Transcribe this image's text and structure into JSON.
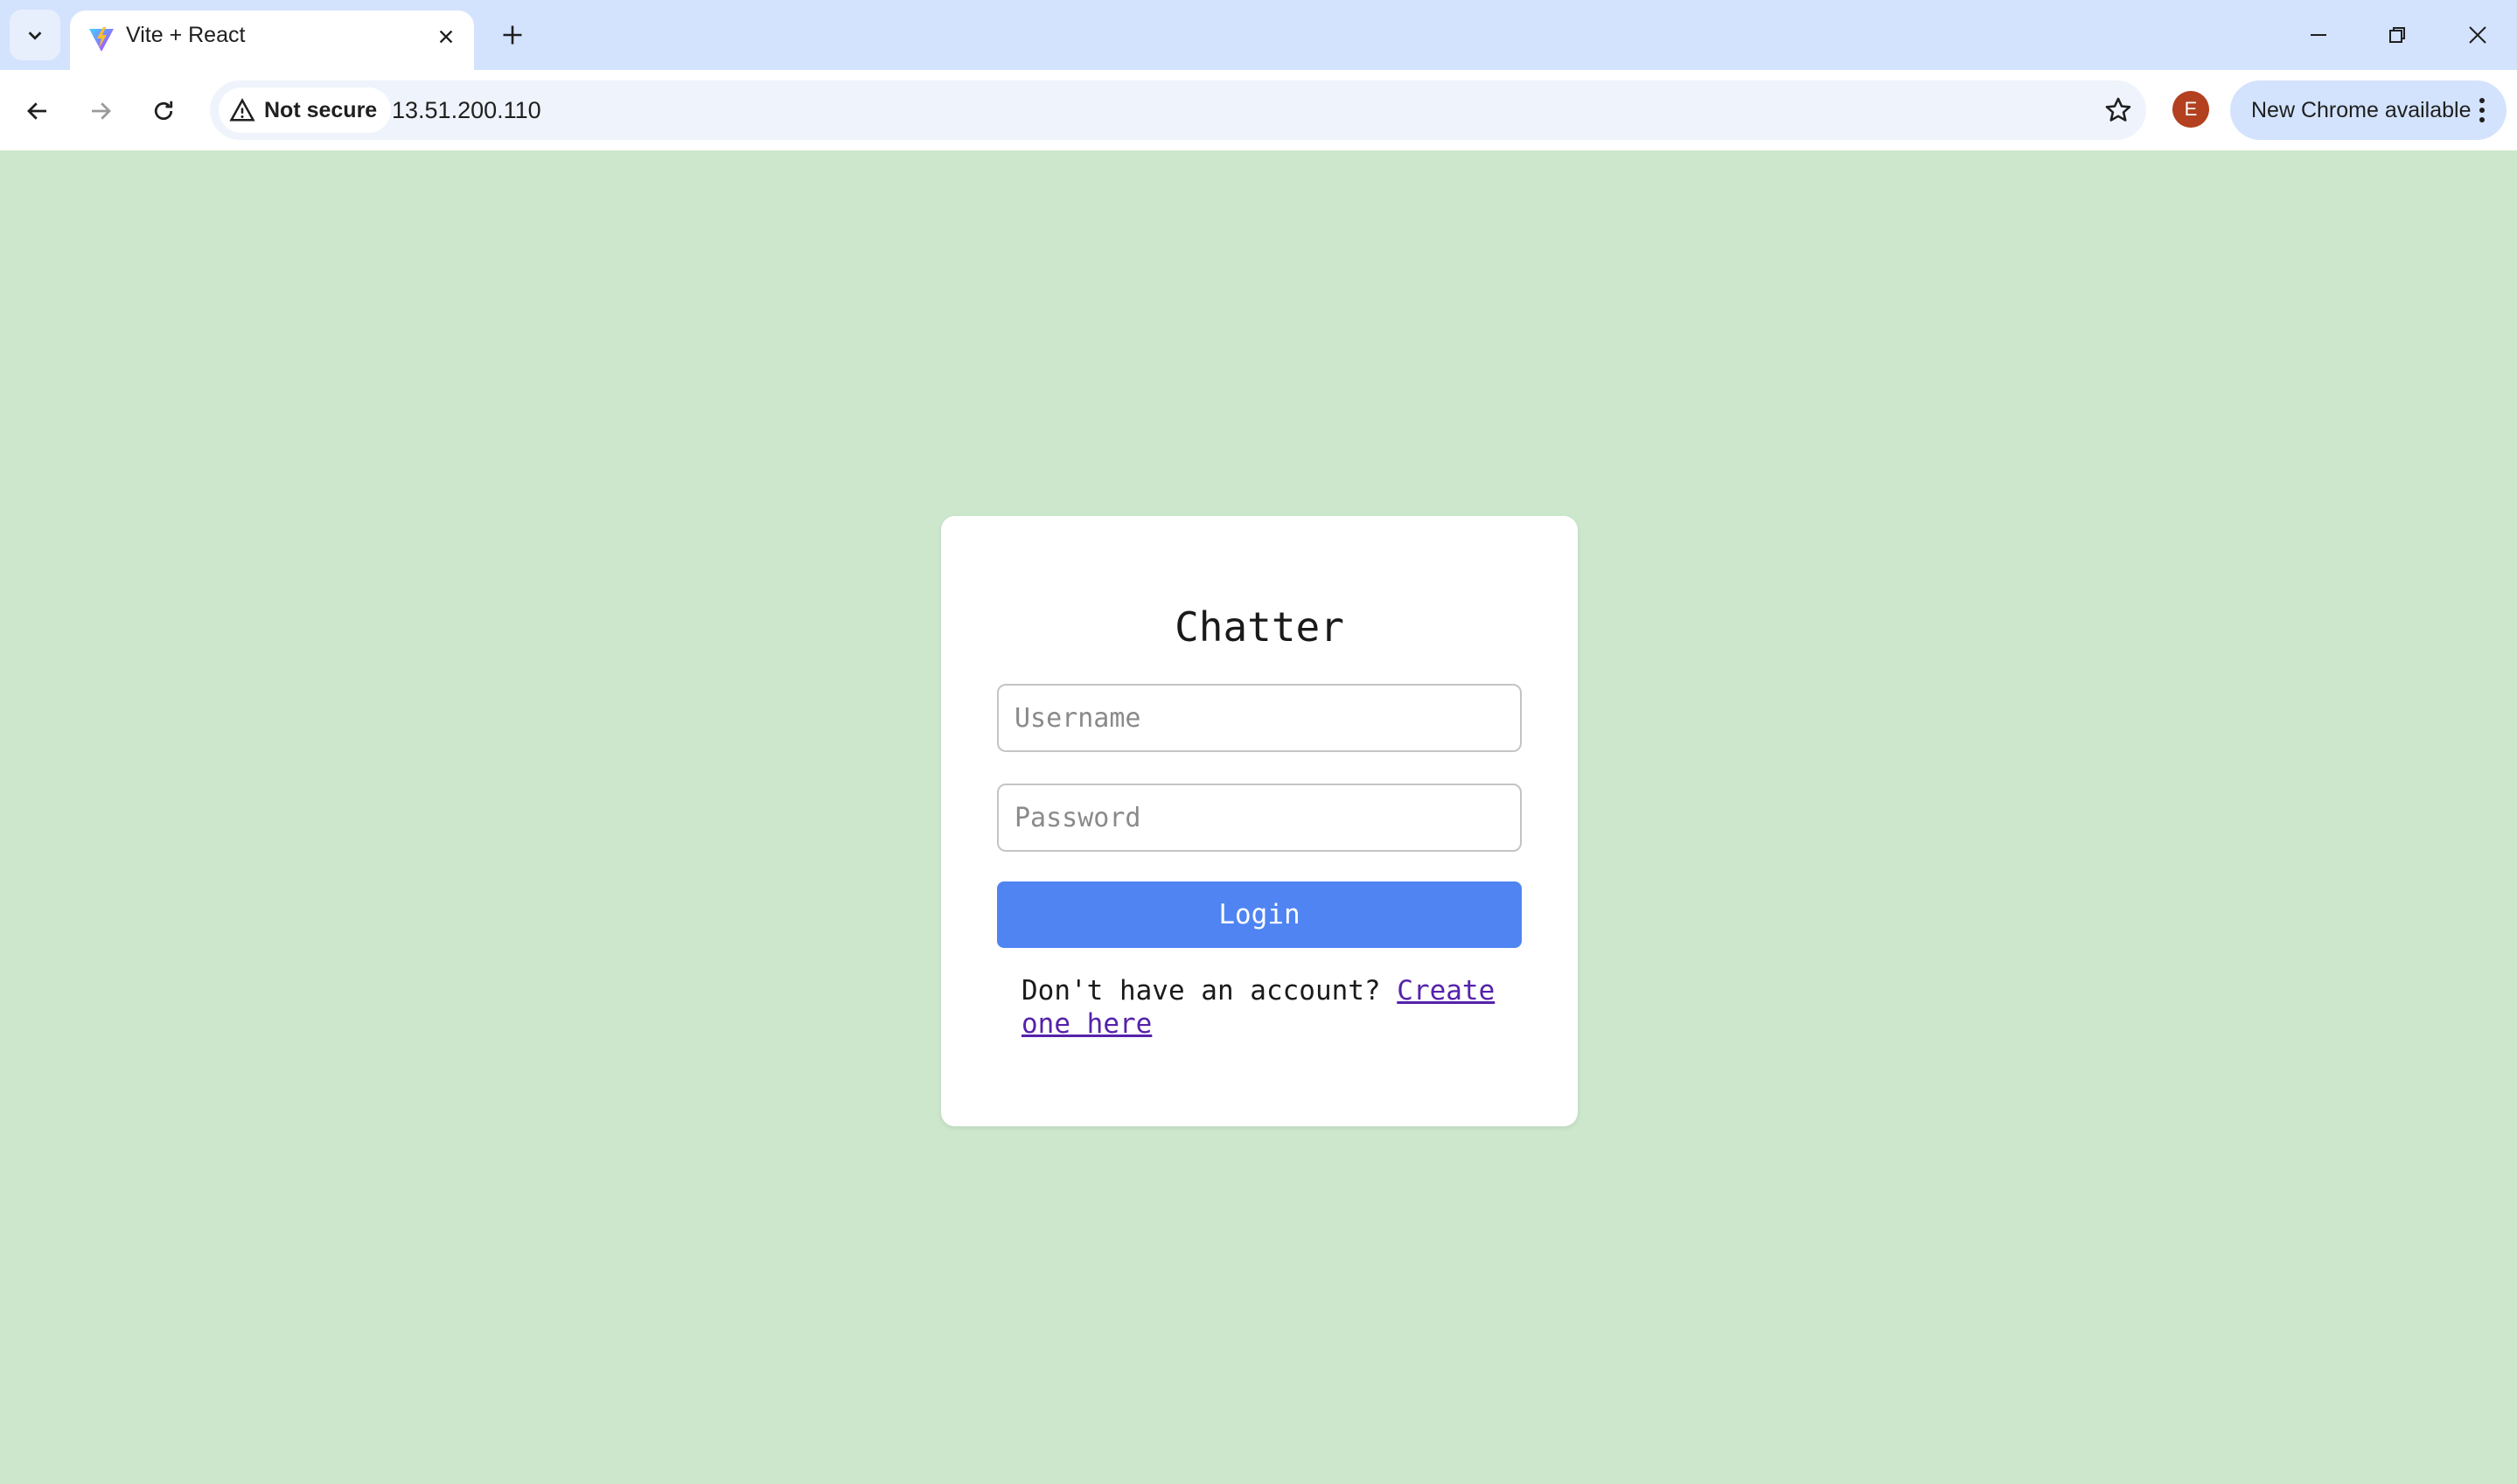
{
  "browser": {
    "tab": {
      "title": "Vite + React"
    },
    "address": {
      "security_label": "Not secure",
      "url": "13.51.200.110"
    },
    "profile_initial": "E",
    "update_label": "New Chrome available"
  },
  "login": {
    "title": "Chatter",
    "username_placeholder": "Username",
    "password_placeholder": "Password",
    "login_label": "Login",
    "signup_prompt": "Don't have an account?",
    "signup_link": "Create one here"
  },
  "colors": {
    "page_background": "#cce7cc",
    "login_button": "#4f84f2",
    "link": "#5522aa",
    "avatar": "#b3401f"
  }
}
